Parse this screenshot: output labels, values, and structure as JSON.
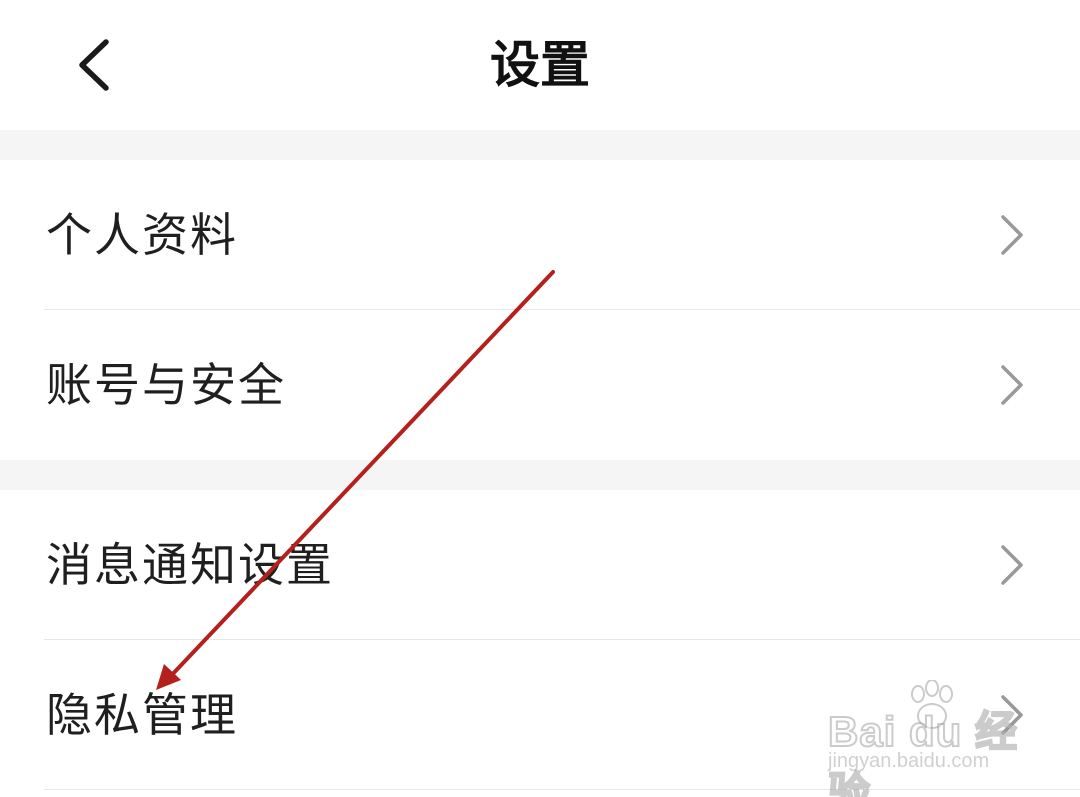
{
  "header": {
    "title": "设置",
    "back_icon": "chevron-left-icon"
  },
  "groups": [
    {
      "items": [
        {
          "label": "个人资料",
          "icon": "chevron-right-icon"
        },
        {
          "label": "账号与安全",
          "icon": "chevron-right-icon"
        }
      ]
    },
    {
      "items": [
        {
          "label": "消息通知设置",
          "icon": "chevron-right-icon"
        },
        {
          "label": "隐私管理",
          "icon": "chevron-right-icon"
        }
      ]
    }
  ],
  "annotation": {
    "color": "#b4211c"
  },
  "watermark": {
    "brand": "Bai du 经验",
    "url": "jingyan.baidu.com"
  },
  "colors": {
    "background": "#ffffff",
    "section_gap": "#f5f5f5",
    "divider": "#e6e6e6",
    "text": "#1f1f1f",
    "chevron": "#999999"
  }
}
